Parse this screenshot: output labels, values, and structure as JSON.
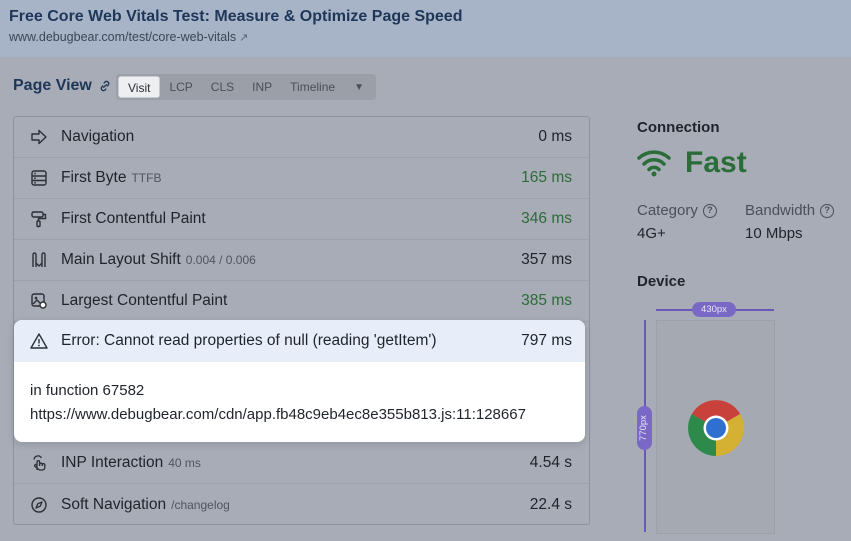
{
  "header": {
    "title": "Free Core Web Vitals Test: Measure & Optimize Page Speed",
    "url": "www.debugbear.com/test/core-web-vitals"
  },
  "page_view": {
    "label": "Page View",
    "tabs": [
      "Visit",
      "LCP",
      "CLS",
      "INP",
      "Timeline"
    ],
    "active_tab": "Visit"
  },
  "timeline": [
    {
      "icon": "arrow-right-icon",
      "label": "Navigation",
      "sub": "",
      "value": "0 ms",
      "good": false
    },
    {
      "icon": "server-icon",
      "label": "First Byte",
      "sub": "TTFB",
      "value": "165 ms",
      "good": true
    },
    {
      "icon": "paint-roller-icon",
      "label": "First Contentful Paint",
      "sub": "",
      "value": "346 ms",
      "good": true
    },
    {
      "icon": "layout-shift-icon",
      "label": "Main Layout Shift",
      "sub": "0.004 / 0.006",
      "value": "357 ms",
      "good": false
    },
    {
      "icon": "image-paint-icon",
      "label": "Largest Contentful Paint",
      "sub": "",
      "value": "385 ms",
      "good": true
    },
    {
      "icon": "tap-icon",
      "label": "INP Interaction",
      "sub": "40 ms",
      "value": "4.54 s",
      "good": false
    },
    {
      "icon": "compass-icon",
      "label": "Soft Navigation",
      "sub": "/changelog",
      "value": "22.4 s",
      "good": false
    }
  ],
  "error": {
    "label": "Error: Cannot read properties of null (reading 'getItem')",
    "value": "797 ms",
    "function": "in function 67582",
    "source": "https://www.debugbear.com/cdn/app.fb48c9eb4ec8e355b813.js:11:128667"
  },
  "connection": {
    "title": "Connection",
    "speed": "Fast",
    "category_label": "Category",
    "category_value": "4G+",
    "bandwidth_label": "Bandwidth",
    "bandwidth_value": "10 Mbps"
  },
  "device": {
    "title": "Device",
    "width_label": "430px",
    "height_label": "770px"
  },
  "colors": {
    "good": "#2d6b3a",
    "accent": "#6a58b8",
    "header": "#1e3657"
  }
}
